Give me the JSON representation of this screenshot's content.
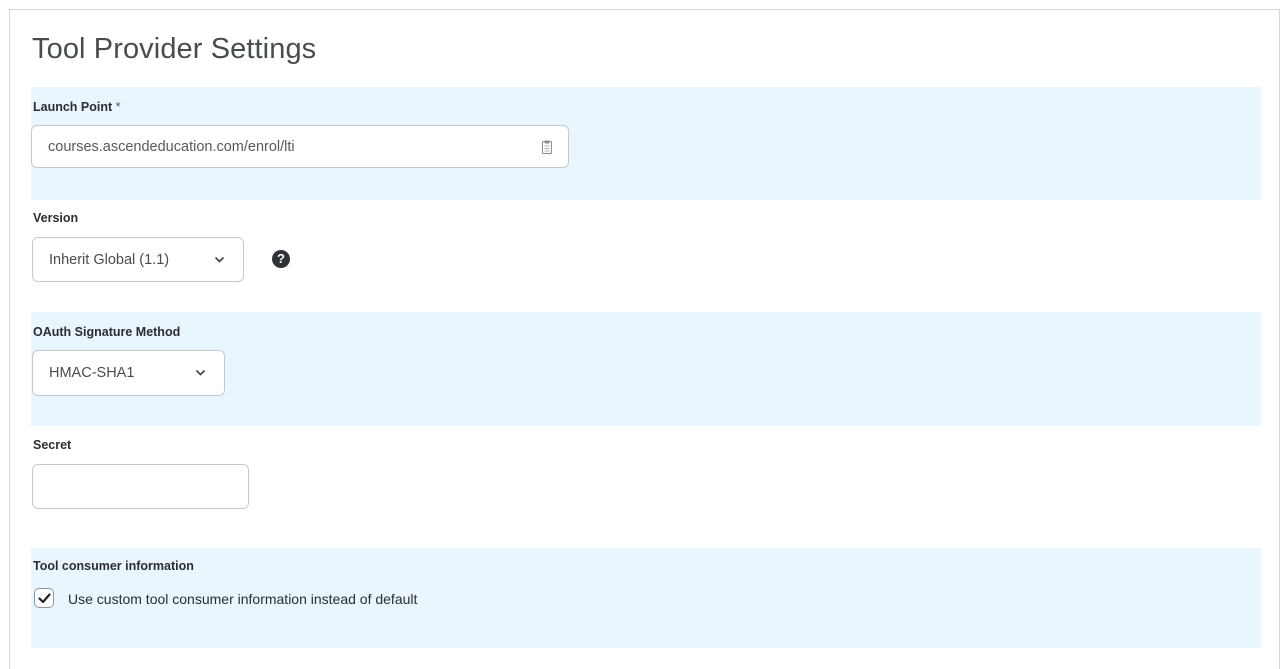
{
  "page": {
    "title": "Tool Provider Settings"
  },
  "launch_point": {
    "label": "Launch Point",
    "required_marker": "*",
    "value": "courses.ascendeducation.com/enrol/lti",
    "icon": "clipboard-icon"
  },
  "version": {
    "label": "Version",
    "selected": "Inherit Global (1.1)",
    "icon": "chevron-down-icon",
    "help_icon": "help-icon",
    "help_glyph": "?"
  },
  "oauth": {
    "label": "OAuth Signature Method",
    "selected": "HMAC-SHA1",
    "icon": "chevron-down-icon"
  },
  "secret": {
    "label": "Secret",
    "value": ""
  },
  "tool_consumer": {
    "label": "Tool consumer information",
    "checkbox_label": "Use custom tool consumer information instead of default",
    "checked": true
  },
  "colors": {
    "shaded_background": "#e9f6fd",
    "border": "#c5c9cf",
    "title": "#494c4e"
  }
}
